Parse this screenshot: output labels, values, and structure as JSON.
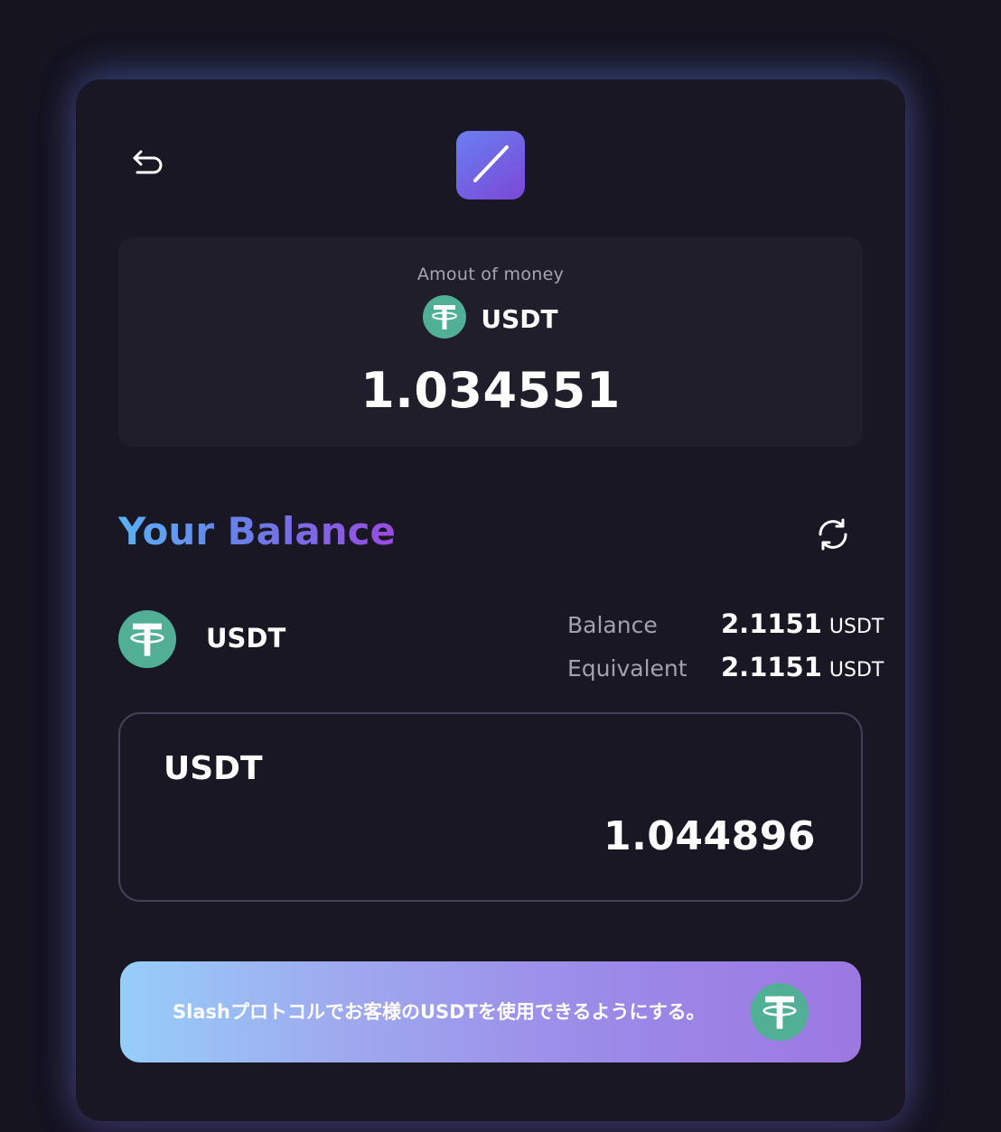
{
  "header": {
    "back_icon": "undo-arrow-icon",
    "logo_icon": "slash-logo-icon"
  },
  "amount": {
    "label": "Amout of money",
    "currency": "USDT",
    "currency_icon": "tether-icon",
    "value": "1.034551"
  },
  "balance": {
    "title": "Your Balance",
    "refresh_icon": "refresh-icon",
    "token": {
      "name": "USDT",
      "icon": "tether-icon"
    },
    "balance_label": "Balance",
    "balance_value": "2.1151",
    "balance_unit": "USDT",
    "equivalent_label": "Equivalent",
    "equivalent_value": "2.1151",
    "equivalent_unit": "USDT"
  },
  "token_input": {
    "name": "USDT",
    "value": "1.044896"
  },
  "cta": {
    "label": "Slashプロトコルでお客様のUSDTを使用できるようにする。",
    "icon": "tether-icon"
  },
  "colors": {
    "background": "#15141f",
    "card": "#181723",
    "panel": "#1f1e2a",
    "tether_green": "#50af95",
    "gradient_start": "#5ab0f5",
    "gradient_end": "#9a4ae0"
  }
}
